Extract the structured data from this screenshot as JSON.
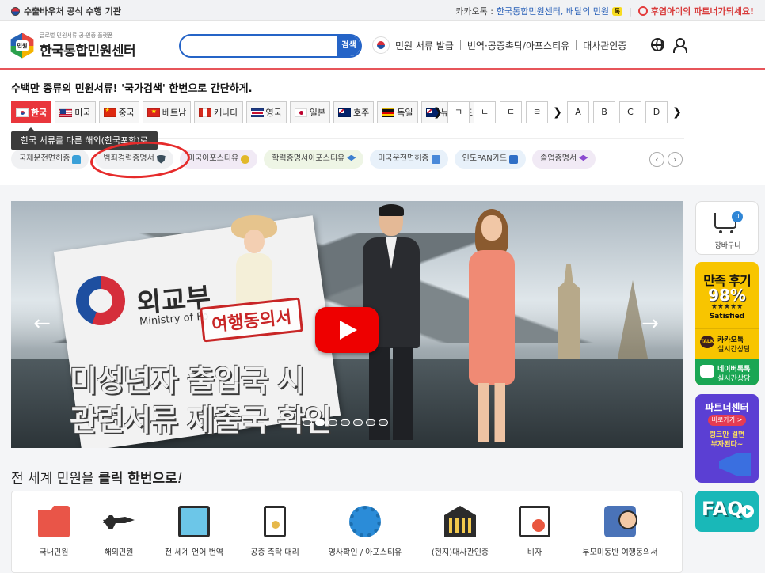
{
  "topbar": {
    "left_text": "수출바우처 공식 수행 기관",
    "kakao_prefix": "카카오톡 :",
    "kakao_channels": "한국통합민원센터, 배달의 민원",
    "kakao_chip": "톡",
    "partner_text": "후염아이의 파트너가되세요!"
  },
  "header": {
    "logo_sub": "글로벌 민원서류 공·인증 플랫폼",
    "logo_main": "한국통합민원센터",
    "logo_mark_text": "민원",
    "search_placeholder": "",
    "search_button": "검색",
    "nav": [
      "민원 서류 발급",
      "번역·공증촉탁/아포스티유",
      "대사관인증"
    ]
  },
  "search_panel": {
    "headline": "수백만 종류의 민원서류! '국가검색' 한번으로 간단하게.",
    "countries": [
      {
        "label": "한국",
        "flag": "kr",
        "active": true
      },
      {
        "label": "미국",
        "flag": "us"
      },
      {
        "label": "중국",
        "flag": "cn"
      },
      {
        "label": "베트남",
        "flag": "vn"
      },
      {
        "label": "캐나다",
        "flag": "ca"
      },
      {
        "label": "영국",
        "flag": "gb"
      },
      {
        "label": "일본",
        "flag": "jp"
      },
      {
        "label": "호주",
        "flag": "au"
      },
      {
        "label": "독일",
        "flag": "de"
      },
      {
        "label": "뉴질랜드",
        "flag": "nz"
      }
    ],
    "arrow": "❯",
    "letters": [
      "ㄱ",
      "ㄴ",
      "ㄷ",
      "ㄹ",
      "A",
      "B",
      "C",
      "D"
    ],
    "tooltip": "한국 서류를 다른 해외(한국포함)로",
    "tags": [
      {
        "label": "국제운전면허증",
        "icon": "car-icon"
      },
      {
        "label": "범죄경력증명서",
        "icon": "shield-icon",
        "highlighted": true
      },
      {
        "label": "미국아포스티유",
        "icon": "medal-icon"
      },
      {
        "label": "학력증명서아포스티유",
        "icon": "cap-icon"
      },
      {
        "label": "미국운전면허증",
        "icon": "card-icon"
      },
      {
        "label": "인도PAN카드",
        "icon": "pan-card-icon"
      },
      {
        "label": "졸업증명서",
        "icon": "graduation-icon"
      }
    ],
    "tag_prev": "‹",
    "tag_next": "›"
  },
  "banner": {
    "ministry_ko": "외교부",
    "ministry_en": "Ministry of Fo",
    "stamp": "여행동의서",
    "line1": "미성년자 출입국 시",
    "line2": "관련서류 제출국 확인",
    "prev_arrow": "←",
    "next_arrow": "→",
    "slide_count": 7,
    "active_slide": 2
  },
  "side": {
    "cart_label": "장바구니",
    "cart_count": "0",
    "review_title": "만족 후기",
    "review_pct": "98%",
    "review_stars": "★★★★★",
    "review_satisfied": "Satisfied",
    "kakao_badge": "TALK",
    "kakao_l1": "카카오톡",
    "kakao_l2": "실시간상담",
    "naver_l1": "네이버톡톡",
    "naver_l2": "실시간상담",
    "partner_title": "파트너센터",
    "partner_btn": "바로가기 >",
    "partner_msg_1": "링크만 걸면",
    "partner_msg_2": "부자된다~",
    "faq": "FAQ"
  },
  "services_section": {
    "title_prefix": "전 세계 민원을 ",
    "title_bold": "클릭 한번으로",
    "title_suffix": "!",
    "items": [
      {
        "label": "국내민원",
        "icon": "folder-icon"
      },
      {
        "label": "해외민원",
        "icon": "airplane-icon"
      },
      {
        "label": "전 세계 언어 번역",
        "icon": "monitor-icon"
      },
      {
        "label": "공증 촉탁 대리",
        "icon": "document-badge-icon"
      },
      {
        "label": "영사확인 / 아포스티유",
        "icon": "gear-seal-icon"
      },
      {
        "label": "(현지)대사관인증",
        "icon": "embassy-icon"
      },
      {
        "label": "비자",
        "icon": "visa-icon"
      },
      {
        "label": "부모미동반 여행동의서",
        "icon": "luggage-icon"
      }
    ]
  },
  "colors": {
    "brand_red": "#e9363c",
    "search_blue": "#2564c7",
    "highlight_circle": "#e62b2b"
  }
}
